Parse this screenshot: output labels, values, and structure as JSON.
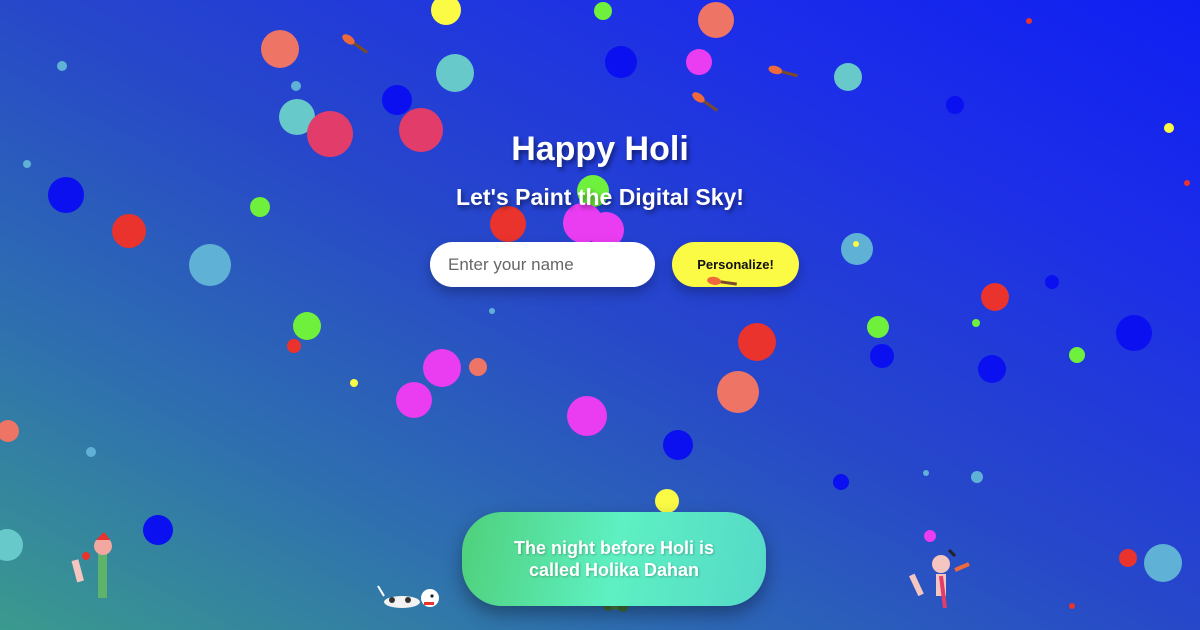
{
  "header": {
    "title": "Happy Holi",
    "subtitle": "Let's Paint the Digital Sky!"
  },
  "form": {
    "name_placeholder": "Enter your name",
    "personalize_label": "Personalize!"
  },
  "fact": {
    "text": "The night before Holi is called Holika Dahan"
  },
  "colors": {
    "background_top_right": "#0f1ff2",
    "background_bottom_left": "#3a9a8e",
    "button_yellow": "#fbfb45",
    "fact_card_green": "#5ef0c2",
    "blue": "#0a10f0",
    "pink": "#ea3cf0",
    "coral": "#ee7466",
    "teal": "#67c9c9",
    "red": "#e9332c",
    "green": "#6ef03c",
    "yellow": "#fbfb45",
    "crimson": "#e23c6a",
    "sky": "#5fb2d6"
  },
  "icons": {
    "paint_brush": "paint-brush-icon"
  }
}
